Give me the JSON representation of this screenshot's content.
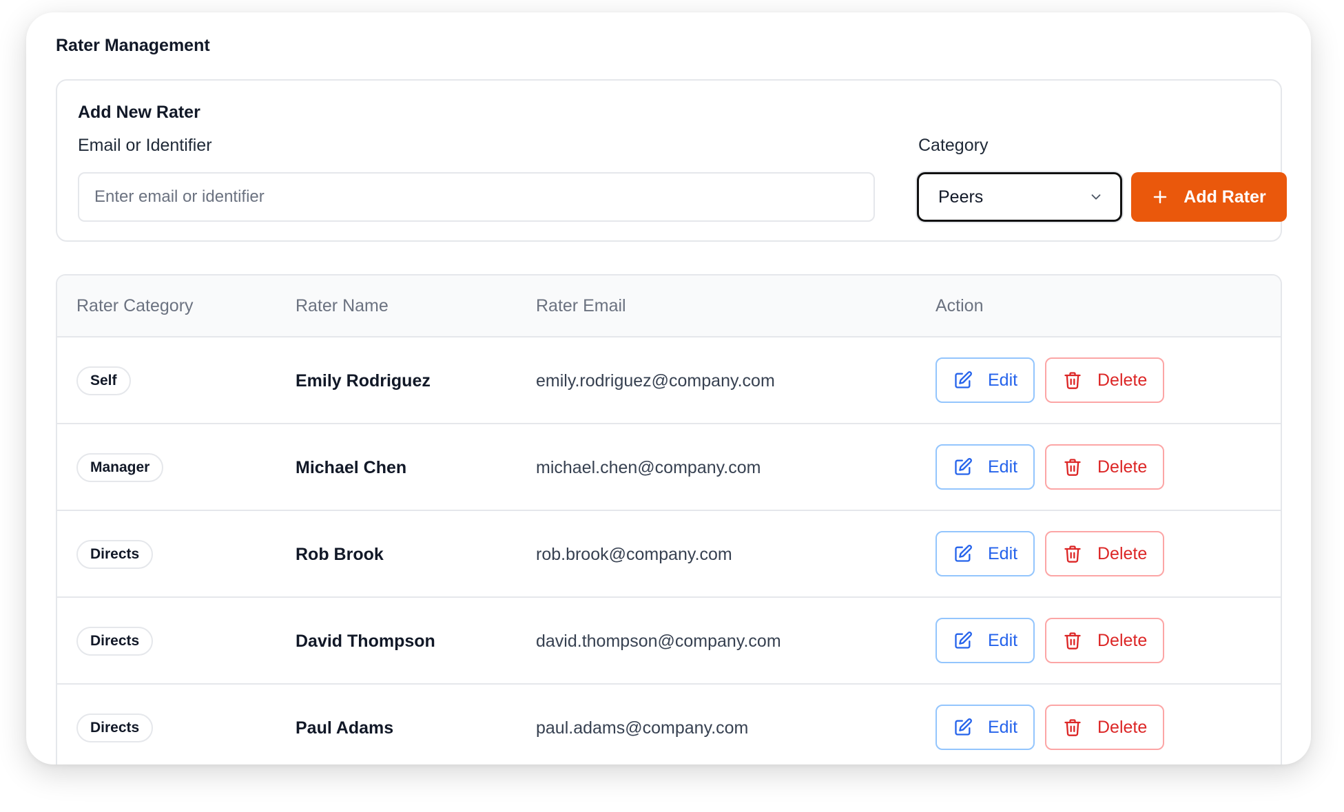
{
  "page": {
    "title": "Rater Management"
  },
  "add_form": {
    "title": "Add New Rater",
    "email_label": "Email or Identifier",
    "email_placeholder": "Enter email or identifier",
    "email_value": "",
    "category_label": "Category",
    "category_value": "Peers",
    "add_button": "Add Rater"
  },
  "table": {
    "headers": [
      "Rater Category",
      "Rater Name",
      "Rater Email",
      "Action"
    ],
    "rows": [
      {
        "category": "Self",
        "name": "Emily Rodriguez",
        "email": "emily.rodriguez@company.com"
      },
      {
        "category": "Manager",
        "name": "Michael Chen",
        "email": "michael.chen@company.com"
      },
      {
        "category": "Directs",
        "name": "Rob Brook",
        "email": "rob.brook@company.com"
      },
      {
        "category": "Directs",
        "name": "David Thompson",
        "email": "david.thompson@company.com"
      },
      {
        "category": "Directs",
        "name": "Paul Adams",
        "email": "paul.adams@company.com"
      }
    ],
    "edit_label": "Edit",
    "delete_label": "Delete"
  },
  "icons": {
    "select": "chevron-down-icon",
    "add": "plus-icon",
    "edit": "edit-icon",
    "delete": "trash-icon"
  },
  "colors": {
    "accent": "#ea580c",
    "edit": "#2563eb",
    "delete": "#dc2626",
    "edit_border": "#93c5fd",
    "delete_border": "#fca5a5"
  }
}
